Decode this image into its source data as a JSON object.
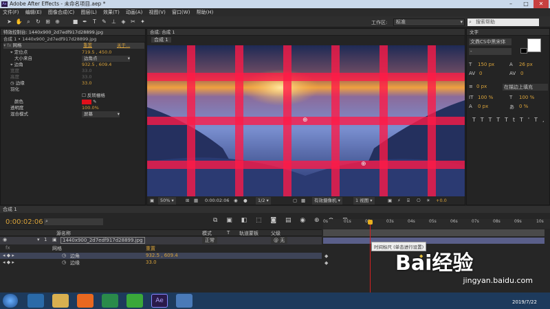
{
  "window": {
    "title": "Adobe After Effects - 未命名项目.aep *",
    "app_icon": "Ae"
  },
  "menu": [
    "文件(F)",
    "编辑(E)",
    "图像合成(C)",
    "图层(L)",
    "效果(T)",
    "动画(A)",
    "视图(V)",
    "窗口(W)",
    "帮助(H)"
  ],
  "toolbar": {
    "workspace_label": "工作区:",
    "workspace_value": "标准",
    "search_placeholder": "搜索帮助"
  },
  "effects_panel": {
    "tab": "特效控制台: 1440x900_2d7edf917d28899.jpg",
    "subheader": "合成 1 • 1440x900_2d7edf917d28899.jpg",
    "effect_name": "网格",
    "reset": "重置",
    "about": "关于...",
    "rows": [
      {
        "label": "定位点",
        "value": "719.5 , 450.0"
      },
      {
        "label": "大小来自",
        "value": "边角点"
      },
      {
        "label": "边角",
        "value": "932.5 , 609.4"
      },
      {
        "label": "宽度",
        "value": "33.0"
      },
      {
        "label": "高度",
        "value": "33.0"
      },
      {
        "label": "边缘",
        "value": "33.0"
      },
      {
        "label": "羽化",
        "value": ""
      },
      {
        "label": "",
        "value": "反转栅格"
      },
      {
        "label": "颜色",
        "value": ""
      },
      {
        "label": "透明度",
        "value": "100.0%"
      },
      {
        "label": "混合模式",
        "value": "屏幕"
      }
    ]
  },
  "composition": {
    "tab": "合成: 合成 1",
    "crumb": "合成 1",
    "grid_color": "#ff1946"
  },
  "viewer_controls": {
    "zoom": "50%",
    "timecode": "0:00:02:06",
    "resolution": "1/2",
    "camera": "有效摄像机",
    "views": "1 视图",
    "exposure": "+0.0"
  },
  "text_panel": {
    "tab": "文字",
    "font": "文鼎CS中黑宋体",
    "style": "-",
    "size": "150 px",
    "leading": "26 px",
    "kerning": "0",
    "tracking": "0",
    "stroke_width": "0 px",
    "stroke_type": "在描边上填充",
    "vscale": "100 %",
    "hscale": "100 %",
    "baseline": "0 px",
    "tsume": "0 %",
    "styles": [
      "T",
      "T",
      "TT",
      "Tt",
      "T'",
      "T,"
    ]
  },
  "timeline": {
    "tab": "合成 1",
    "timecode": "0:00:02:06",
    "columns": [
      "源名称",
      "模式",
      "T",
      "轨道蒙板",
      "父级"
    ],
    "layer": {
      "index": "1",
      "name": "1440x900_2d7edf917d28899.jpg",
      "mode": "正常",
      "parent": "无"
    },
    "effect": "网格",
    "reset": "重置",
    "prop1": {
      "label": "边角",
      "value": "932.5 , 609.4"
    },
    "prop2": {
      "label": "边缘",
      "value": "33.0"
    },
    "ruler_ticks": [
      "0s",
      "01s",
      "02s",
      "03s",
      "04s",
      "05s",
      "06s",
      "07s",
      "08s",
      "09s",
      "10s"
    ],
    "tooltip": "时间标尺 (单击进行设置)",
    "playhead_seconds": 2.2
  },
  "taskbar": {
    "clock": "2019/7/22",
    "app": "Ae"
  },
  "watermark": {
    "brand": "Bai经验",
    "url": "jingyan.baidu.com"
  }
}
